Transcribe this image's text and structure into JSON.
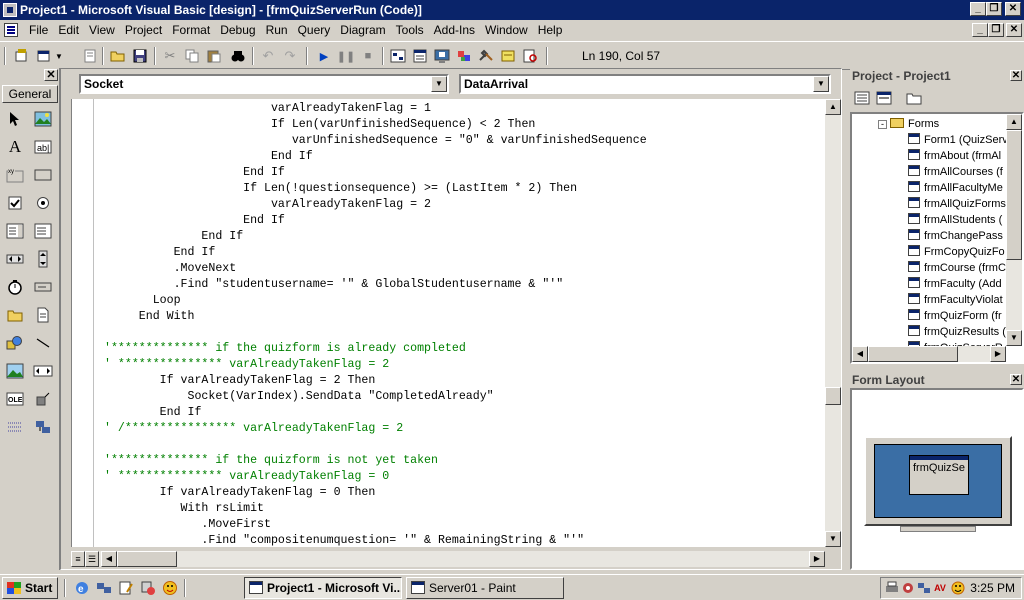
{
  "window": {
    "title": "Project1 - Microsoft Visual Basic [design] - [frmQuizServerRun (Code)]",
    "caption_buttons": [
      "_",
      "❐",
      "✕"
    ],
    "mdi_buttons": [
      "_",
      "❐",
      "✕"
    ]
  },
  "menu": {
    "items": [
      "File",
      "Edit",
      "View",
      "Project",
      "Format",
      "Debug",
      "Run",
      "Query",
      "Diagram",
      "Tools",
      "Add-Ins",
      "Window",
      "Help"
    ]
  },
  "toolbar": {
    "position_text": "Ln 190, Col 57"
  },
  "toolbox": {
    "tab_label": "General",
    "close": "✕"
  },
  "code_window": {
    "object_combo": "Socket",
    "procedure_combo": "DataArrival",
    "lines": [
      {
        "text": "                        varAlreadyTakenFlag = 1",
        "comment": false
      },
      {
        "text": "                        If Len(varUnfinishedSequence) < 2 Then",
        "comment": false
      },
      {
        "text": "                           varUnfinishedSequence = \"0\" & varUnfinishedSequence",
        "comment": false
      },
      {
        "text": "                        End If",
        "comment": false
      },
      {
        "text": "                    End If",
        "comment": false
      },
      {
        "text": "                    If Len(!questionsequence) >= (LastItem * 2) Then",
        "comment": false
      },
      {
        "text": "                        varAlreadyTakenFlag = 2",
        "comment": false
      },
      {
        "text": "                    End If",
        "comment": false
      },
      {
        "text": "              End If",
        "comment": false
      },
      {
        "text": "          End If",
        "comment": false
      },
      {
        "text": "          .MoveNext",
        "comment": false
      },
      {
        "text": "          .Find \"studentusername= '\" & GlobalStudentusername & \"'\"",
        "comment": false
      },
      {
        "text": "       Loop",
        "comment": false
      },
      {
        "text": "     End With",
        "comment": false
      },
      {
        "text": "",
        "comment": false
      },
      {
        "text": "'************** if the quizform is already completed",
        "comment": true
      },
      {
        "text": "' *************** varAlreadyTakenFlag = 2",
        "comment": true
      },
      {
        "text": "        If varAlreadyTakenFlag = 2 Then",
        "comment": false
      },
      {
        "text": "            Socket(VarIndex).SendData \"CompletedAlready\"",
        "comment": false
      },
      {
        "text": "        End If",
        "comment": false
      },
      {
        "text": "' /**************** varAlreadyTakenFlag = 2",
        "comment": true
      },
      {
        "text": "",
        "comment": false
      },
      {
        "text": "'************** if the quizform is not yet taken",
        "comment": true
      },
      {
        "text": "' *************** varAlreadyTakenFlag = 0",
        "comment": true
      },
      {
        "text": "        If varAlreadyTakenFlag = 0 Then",
        "comment": false
      },
      {
        "text": "           With rsLimit",
        "comment": false
      },
      {
        "text": "              .MoveFirst",
        "comment": false
      },
      {
        "text": "              .Find \"compositenumquestion= '\" & RemainingString & \"'\"",
        "comment": false
      }
    ]
  },
  "project_panel": {
    "title": "Project - Project1",
    "close": "✕",
    "folder": "Forms",
    "forms": [
      "Form1 (QuizServ",
      "frmAbout (frmAl",
      "frmAllCourses (f",
      "frmAllFacultyMe",
      "frmAllQuizForms",
      "frmAllStudents (",
      "frmChangePass",
      "FrmCopyQuizFo",
      "frmCourse (frmC",
      "frmFaculty (Add",
      "frmFacultyViolat",
      "frmQuizForm (fr",
      "frmQuizResults (",
      "frmQuizServerR"
    ]
  },
  "layout_panel": {
    "title": "Form Layout",
    "close": "✕",
    "form_label": "frmQuizSe"
  },
  "taskbar": {
    "start_label": "Start",
    "tasks": [
      {
        "label": "Project1 - Microsoft Vi...",
        "active": true
      },
      {
        "label": "Server01 - Paint",
        "active": false
      }
    ],
    "clock": "3:25 PM"
  },
  "colors": {
    "titlebar": "#0a246a",
    "comment": "#008000",
    "desktop": "#3a6ea5",
    "face": "#d4d0c8"
  }
}
